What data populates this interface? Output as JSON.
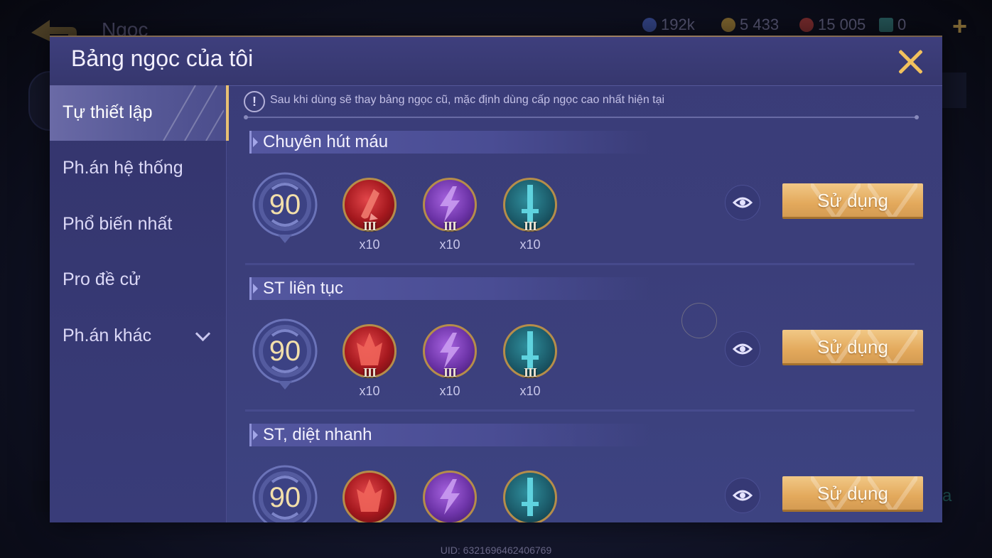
{
  "background": {
    "title": "Ngọc",
    "currencies": [
      {
        "icon": "blue-coin-icon",
        "value": "192k",
        "color": "#4f6bd1"
      },
      {
        "icon": "gold-coin-icon",
        "value": "5 433",
        "color": "#d3a53b"
      },
      {
        "icon": "red-gem-icon",
        "value": "15 005",
        "color": "#c8413a"
      },
      {
        "icon": "card-icon",
        "value": "0",
        "color": "#3a8f8a"
      }
    ],
    "uid": "UID: 6321696462406769",
    "right_edge_text": "a"
  },
  "modal": {
    "title": "Bảng ngọc của tôi",
    "close_icon": "close-icon"
  },
  "sidebar": {
    "items": [
      {
        "label": "Tự thiết lập",
        "active": true
      },
      {
        "label": "Ph.án hệ thống",
        "active": false
      },
      {
        "label": "Phổ biến nhất",
        "active": false
      },
      {
        "label": "Pro đề cử",
        "active": false
      },
      {
        "label": "Ph.án khác",
        "active": false,
        "has_chevron": true
      }
    ]
  },
  "notice": {
    "text": "Sau khi dùng sẽ thay bảng ngọc cũ, mặc định dùng cấp ngọc cao nhất hiện tại"
  },
  "rows": [
    {
      "title": "Chuyên hút máu",
      "level": "90",
      "gems": [
        {
          "color": "red",
          "icon": "blood-drop-icon",
          "tier": "III",
          "count": "x10"
        },
        {
          "color": "purple",
          "icon": "lightning-icon",
          "tier": "III",
          "count": "x10"
        },
        {
          "color": "teal",
          "icon": "sword-icon",
          "tier": "III",
          "count": "x10"
        }
      ],
      "button": "Sử dụng"
    },
    {
      "title": "ST liên tục",
      "level": "90",
      "gems": [
        {
          "color": "red",
          "icon": "flame-icon",
          "tier": "III",
          "count": "x10"
        },
        {
          "color": "purple",
          "icon": "lightning-icon",
          "tier": "III",
          "count": "x10"
        },
        {
          "color": "teal",
          "icon": "sword-icon",
          "tier": "III",
          "count": "x10"
        }
      ],
      "button": "Sử dụng"
    },
    {
      "title": "ST, diệt nhanh",
      "level": "90",
      "gems": [
        {
          "color": "red",
          "icon": "flame-icon",
          "tier": "",
          "count": ""
        },
        {
          "color": "purple",
          "icon": "lightning-icon",
          "tier": "",
          "count": ""
        },
        {
          "color": "teal",
          "icon": "sword-icon",
          "tier": "",
          "count": ""
        }
      ],
      "button": "Sử dụng"
    }
  ]
}
